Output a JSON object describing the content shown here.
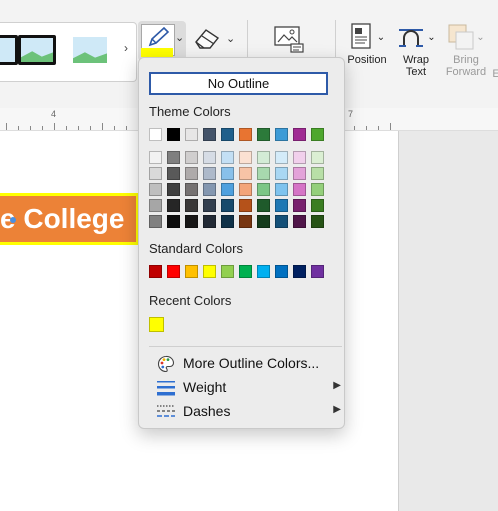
{
  "ribbon": {
    "gallery_more": "›",
    "pen_chevron": "⌄",
    "eraser_chevron": "⌄",
    "position_label": "Position",
    "wrap_label_1": "Wrap",
    "wrap_label_2": "Text",
    "bring_label_1": "Bring",
    "bring_label_2": "Forward",
    "bring_label_3": "E",
    "pen_color": "#ffff00"
  },
  "ruler": {
    "marks": [
      "4",
      "7"
    ]
  },
  "document": {
    "shape_text": "e College",
    "shape_fill": "#ec8237",
    "shape_outline": "#ffff00"
  },
  "menu": {
    "no_outline": "No Outline",
    "theme_label": "Theme Colors",
    "theme_top": [
      "#ffffff",
      "#000000",
      "#e7e6e6",
      "#44546a",
      "#1f5f8b",
      "#e87431",
      "#2c7a3a",
      "#3d9bd6",
      "#a02b93",
      "#4ea72e"
    ],
    "theme_shades": [
      [
        "#f2f2f2",
        "#7f7f7f",
        "#d0cece",
        "#d6dce5",
        "#c3dff4",
        "#fbe1d2",
        "#d3ecd6",
        "#d4ebf9",
        "#f1d0ec",
        "#dbefd3"
      ],
      [
        "#d9d9d9",
        "#595959",
        "#aeaaaa",
        "#adb9ca",
        "#88c0ea",
        "#f7c3a6",
        "#a8d9ae",
        "#a9d7f3",
        "#e3a2d9",
        "#b8dfa7"
      ],
      [
        "#bfbfbf",
        "#3f3f3f",
        "#757171",
        "#8497b0",
        "#4ea0de",
        "#f3a57a",
        "#7cc686",
        "#7ec3ee",
        "#d574c6",
        "#94cf7b"
      ],
      [
        "#a6a6a6",
        "#262626",
        "#3a3838",
        "#333f4f",
        "#174a6c",
        "#b5521a",
        "#1f5a2b",
        "#1f78b4",
        "#78206e",
        "#3a7d22"
      ],
      [
        "#808080",
        "#0d0d0d",
        "#171616",
        "#222a35",
        "#0f3148",
        "#783611",
        "#153c1d",
        "#145078",
        "#501549",
        "#275416"
      ]
    ],
    "standard_label": "Standard Colors",
    "standard": [
      "#c00000",
      "#ff0000",
      "#ffc000",
      "#ffff00",
      "#92d050",
      "#00b050",
      "#00b0f0",
      "#0070c0",
      "#002060",
      "#7030a0"
    ],
    "recent_label": "Recent Colors",
    "recent": [
      "#ffff00"
    ],
    "more_colors": "More Outline Colors...",
    "weight": "Weight",
    "dashes": "Dashes",
    "submenu_arrow": "▶"
  }
}
